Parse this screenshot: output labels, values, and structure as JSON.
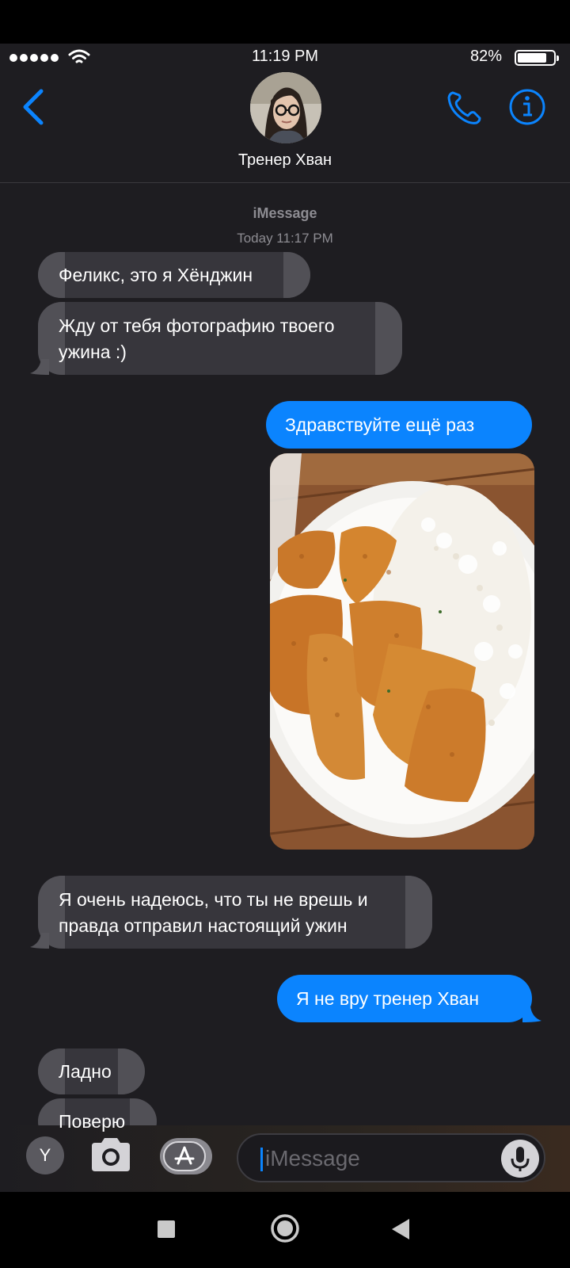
{
  "status_bar": {
    "time": "11:19 PM",
    "battery_percent": "82%",
    "battery_level": 0.82,
    "signal_icon": "signal-dots-icon",
    "wifi_icon": "wifi-icon"
  },
  "header": {
    "contact_name": "Тренер Хван",
    "back_icon": "chevron-left-icon",
    "call_icon": "phone-icon",
    "info_icon": "info-icon"
  },
  "conversation": {
    "service_label": "iMessage",
    "timestamp": "Today 11:17 PM",
    "messages": [
      {
        "direction": "incoming",
        "text": "Феликс, это я Хёнджин"
      },
      {
        "direction": "incoming",
        "text_lines": [
          "Жду от тебя фотографию твоего",
          "ужина :)"
        ]
      },
      {
        "direction": "outgoing",
        "text": "Здравствуйте ещё раз"
      },
      {
        "direction": "outgoing",
        "type": "photo",
        "content": "chicken-cutlet-with-rice-photo"
      },
      {
        "direction": "incoming",
        "text_lines": [
          "Я очень надеюсь, что ты не врешь и",
          "правда отправил настоящий ужин"
        ]
      },
      {
        "direction": "outgoing",
        "text": "Я не вру тренер Хван"
      },
      {
        "direction": "incoming",
        "text": "Ладно"
      },
      {
        "direction": "incoming",
        "text": "Поверю"
      }
    ]
  },
  "input_bar": {
    "y_button_label": "Y",
    "camera_icon": "camera-icon",
    "apps_icon": "app-store-icon",
    "placeholder": "iMessage",
    "mic_icon": "microphone-icon"
  },
  "colors": {
    "accent": "#0b84fe",
    "background": "#1e1d21",
    "incoming_bubble": "#37363c",
    "secondary_text": "#8d8c92"
  }
}
